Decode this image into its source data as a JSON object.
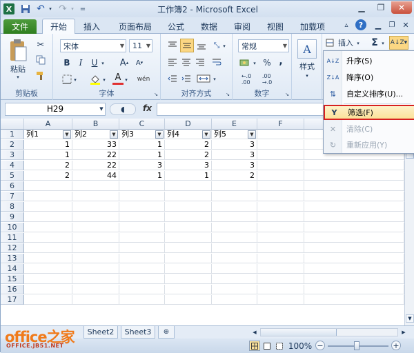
{
  "window": {
    "title": "工作簿2 - Microsoft Excel"
  },
  "qat": {
    "app_icon": "X",
    "save_icon": "floppy-icon",
    "undo_icon": "↶",
    "redo_icon": "↷",
    "customize": "="
  },
  "tabs": [
    "文件",
    "开始",
    "插入",
    "页面布局",
    "公式",
    "数据",
    "审阅",
    "视图",
    "加载项"
  ],
  "ribbon": {
    "clipboard": {
      "paste": "粘贴",
      "label": "剪贴板"
    },
    "font": {
      "name": "宋体",
      "size": "11",
      "bold": "B",
      "italic": "I",
      "underline": "U",
      "grow": "A",
      "shrink": "A",
      "font_color": "A",
      "wen": "wén",
      "label": "字体"
    },
    "alignment": {
      "label": "对齐方式"
    },
    "number": {
      "format": "常规",
      "percent": "%",
      "comma": ",",
      "label": "数字"
    },
    "styles": {
      "label": "样式"
    },
    "cells": {
      "insert": "插入"
    },
    "editing": {
      "sigma": "Σ"
    }
  },
  "formula_bar": {
    "name_box": "H29",
    "fx": "fx",
    "value": ""
  },
  "columns": [
    "A",
    "B",
    "C",
    "D",
    "E",
    "F"
  ],
  "rows": [
    "1",
    "2",
    "3",
    "4",
    "5",
    "6",
    "7",
    "8",
    "9",
    "10",
    "11",
    "12",
    "13",
    "14",
    "15",
    "16",
    "17"
  ],
  "headers": [
    "列1",
    "列2",
    "列3",
    "列4",
    "列5"
  ],
  "data": [
    [
      "1",
      "33",
      "1",
      "2",
      "3"
    ],
    [
      "1",
      "22",
      "1",
      "2",
      "3"
    ],
    [
      "2",
      "22",
      "3",
      "3",
      "3"
    ],
    [
      "2",
      "44",
      "1",
      "1",
      "2"
    ]
  ],
  "sheet_tabs": [
    "Sheet2",
    "Sheet3"
  ],
  "status": {
    "zoom": "100%",
    "minus": "−",
    "plus": "+"
  },
  "watermark": {
    "brand": "office之家",
    "url": "OFFICE.JB51.NET"
  },
  "sort_filter_menu": {
    "items": [
      {
        "label": "升序(S)",
        "icon": "A↓Z"
      },
      {
        "label": "降序(O)",
        "icon": "Z↓A"
      },
      {
        "label": "自定义排序(U)...",
        "icon": "⇅"
      },
      {
        "label": "筛选(F)",
        "icon": "Y"
      },
      {
        "label": "清除(C)",
        "icon": "✕"
      },
      {
        "label": "重新应用(Y)",
        "icon": "↻"
      }
    ]
  }
}
